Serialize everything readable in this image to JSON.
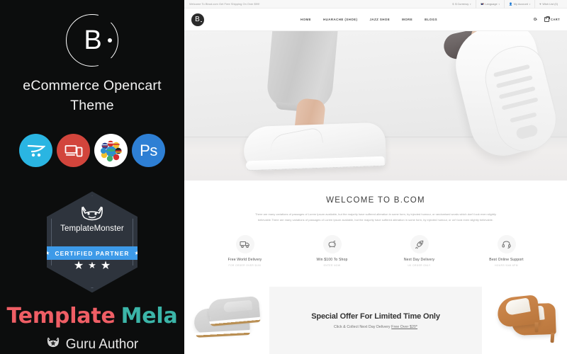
{
  "promo": {
    "brand_letter": "B",
    "title_line1": "eCommerce Opencart",
    "title_line2": "Theme",
    "feature_icons": [
      {
        "name": "opencart-icon",
        "label": "OpenCart"
      },
      {
        "name": "responsive-devices-icon",
        "label": "Responsive"
      },
      {
        "name": "multilanguage-flags-icon",
        "label": "Multi Language"
      },
      {
        "name": "photoshop-icon",
        "label": "Ps"
      }
    ],
    "badge": {
      "monster_name": "TemplateMonster",
      "certified_label": "CERTIFIED PARTNER",
      "star": "★"
    },
    "author_name_part1": "Template",
    "author_name_part2": "Mela",
    "author_role": "Guru Author"
  },
  "site": {
    "topbar": {
      "announcement": "Welcome To Bbod.com Get Free Shipping On Over $99!",
      "items": [
        {
          "name": "currency-selector",
          "label": "$ Currency",
          "caret": "▾"
        },
        {
          "name": "language-selector",
          "label": "Language",
          "caret": "▾"
        },
        {
          "name": "my-account-menu",
          "label": "My Account",
          "caret": "▾"
        },
        {
          "name": "wish-list-link",
          "label": "Wish List (0)",
          "caret": ""
        }
      ]
    },
    "header": {
      "logo_letter": "B",
      "nav": [
        {
          "name": "nav-home",
          "label": "HOME"
        },
        {
          "name": "nav-huarache-shoe",
          "label": "HUARACHE (SHOE)"
        },
        {
          "name": "nav-jazz-shoe",
          "label": "JAZZ SHOE"
        },
        {
          "name": "nav-more",
          "label": "MORE"
        },
        {
          "name": "nav-blogs",
          "label": "BLOGS"
        }
      ],
      "cart_label": "CART"
    },
    "welcome": {
      "heading": "WELCOME TO B.COM",
      "paragraph": "There are many variations of passages of Lorem Ipsum available, but the majority have suffered alteration in some form, by injected humour, or randomised words which don't look even slightly believable.There are many variations of passages of Lorem Ipsum available, but the majority have suffered alteration in some form, by injected humour, or on't look even slightly believable."
    },
    "services": [
      {
        "icon": "delivery-truck-icon",
        "title": "Free World Delivery",
        "subtitle": "For Order Over $100"
      },
      {
        "icon": "piggy-bank-icon",
        "title": "Win $100 To Shop",
        "subtitle": "Enter Now"
      },
      {
        "icon": "rocket-icon",
        "title": "Next Day Delivery",
        "subtitle": "UK Order Only"
      },
      {
        "icon": "headset-icon",
        "title": "Best Online Support",
        "subtitle": "Hours 9AM-6PM"
      }
    ],
    "offer": {
      "heading": "Special Offer For Limited Time Only",
      "subtitle_plain": "Click & Collect Next Day Delivery ",
      "subtitle_underlined": "Free Over $20*"
    }
  }
}
